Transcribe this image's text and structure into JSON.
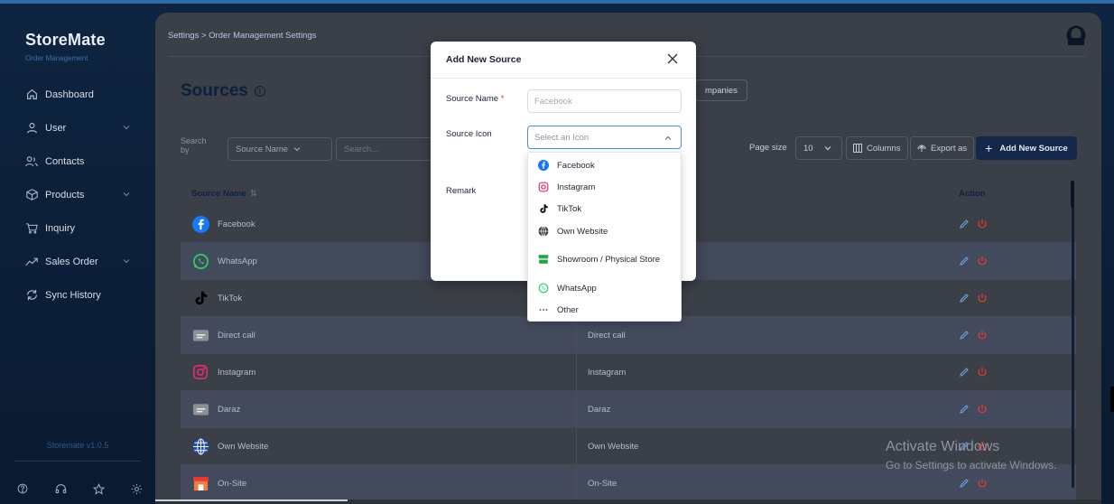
{
  "brand": {
    "name": "StoreMate",
    "subtitle": "Order Management"
  },
  "sidebar": {
    "items": [
      {
        "label": "Dashboard",
        "icon": "home-icon",
        "has_chevron": false
      },
      {
        "label": "User",
        "icon": "user-icon",
        "has_chevron": true
      },
      {
        "label": "Contacts",
        "icon": "contacts-icon",
        "has_chevron": false
      },
      {
        "label": "Products",
        "icon": "box-icon",
        "has_chevron": true
      },
      {
        "label": "Inquiry",
        "icon": "cart-icon",
        "has_chevron": false
      },
      {
        "label": "Sales Order",
        "icon": "trend-icon",
        "has_chevron": true
      },
      {
        "label": "Sync History",
        "icon": "sync-icon",
        "has_chevron": false
      }
    ],
    "version": "Storemate v1.0.5"
  },
  "header": {
    "breadcrumb": "Settings > Order Management Settings"
  },
  "page": {
    "title": "Sources",
    "companies_btn": "mpanies"
  },
  "toolbar": {
    "search_by": "Search by",
    "field": "Source Name",
    "search_placeholder": "Search...",
    "page_size_label": "Page size",
    "page_size": "10",
    "columns": "Columns",
    "export": "Export as",
    "add_new": "Add New Source"
  },
  "table": {
    "headers": {
      "name": "Source Name",
      "action": "Action"
    },
    "rows": [
      {
        "name": "Facebook",
        "col2": "",
        "icon": "facebook-icon"
      },
      {
        "name": "WhatsApp",
        "col2": "",
        "icon": "whatsapp-icon"
      },
      {
        "name": "TikTok",
        "col2": "",
        "icon": "tiktok-icon"
      },
      {
        "name": "Direct call",
        "col2": "Direct call",
        "icon": "folder-icon"
      },
      {
        "name": "Instagram",
        "col2": "Instagram",
        "icon": "instagram-icon"
      },
      {
        "name": "Daraz",
        "col2": "Daraz",
        "icon": "folder-icon"
      },
      {
        "name": "Own Website",
        "col2": "Own Website",
        "icon": "globe-icon"
      },
      {
        "name": "On-Site",
        "col2": "On-Site",
        "icon": "store-icon"
      }
    ]
  },
  "modal": {
    "title": "Add New Source",
    "source_name_label": "Source Name",
    "required_mark": "*",
    "source_name_placeholder": "Facebook",
    "source_icon_label": "Source Icon",
    "source_icon_placeholder": "Select an Icon",
    "remark_label": "Remark",
    "options": [
      {
        "label": "Facebook",
        "icon": "facebook-icon"
      },
      {
        "label": "Instagram",
        "icon": "instagram-icon"
      },
      {
        "label": "TikTok",
        "icon": "tiktok-icon"
      },
      {
        "label": "Own Website",
        "icon": "globe-icon"
      },
      {
        "label": "Showroom / Physical Store",
        "icon": "store-icon"
      },
      {
        "label": "WhatsApp",
        "icon": "whatsapp-icon"
      },
      {
        "label": "Other",
        "icon": "more-icon"
      }
    ]
  },
  "watermark": {
    "line1": "Activate Windows",
    "line2": "Go to Settings to activate Windows."
  },
  "colors": {
    "accent": "#13284a",
    "facebook": "#1877f2",
    "whatsapp": "#25d366",
    "instagram": "#e1306c",
    "danger": "#e53935"
  }
}
